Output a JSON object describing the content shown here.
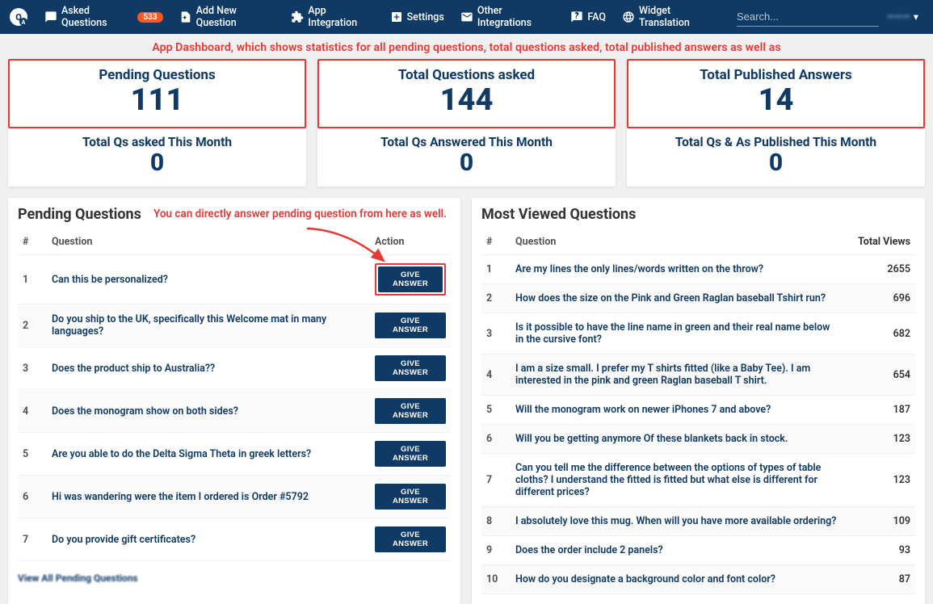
{
  "nav": {
    "items": [
      {
        "label": "Asked Questions",
        "badge": "533",
        "icon": "chat-icon"
      },
      {
        "label": "Add New Question",
        "icon": "note-add-icon"
      },
      {
        "label": "App Integration",
        "icon": "puzzle-icon"
      },
      {
        "label": "Settings",
        "icon": "plus-box-icon"
      },
      {
        "label": "Other Integrations",
        "icon": "mail-icon"
      },
      {
        "label": "FAQ",
        "icon": "faq-icon"
      },
      {
        "label": "Widget Translation",
        "icon": "globe-icon"
      }
    ],
    "search_placeholder": "Search...",
    "user_label": "———"
  },
  "annotations": {
    "banner": "App Dashboard, which shows statistics for all pending questions, total questions asked, total published answers as well as",
    "inline_pending": "You can directly answer pending question from here as well."
  },
  "stats": [
    {
      "top_label": "Pending Questions",
      "top_value": "111",
      "bottom_label": "Total Qs asked This Month",
      "bottom_value": "0"
    },
    {
      "top_label": "Total Questions asked",
      "top_value": "144",
      "bottom_label": "Total Qs Answered This Month",
      "bottom_value": "0"
    },
    {
      "top_label": "Total Published Answers",
      "top_value": "14",
      "bottom_label": "Total Qs & As Published This Month",
      "bottom_value": "0"
    }
  ],
  "pending": {
    "title": "Pending Questions",
    "headers": {
      "idx": "#",
      "question": "Question",
      "action": "Action"
    },
    "action_label": "GIVE ANSWER",
    "rows": [
      {
        "idx": "1",
        "q": "Can this be personalized?"
      },
      {
        "idx": "2",
        "q": "Do you ship to the UK, specifically this Welcome mat in many languages?"
      },
      {
        "idx": "3",
        "q": "Does the product ship to Australia??"
      },
      {
        "idx": "4",
        "q": "Does the monogram show on both sides?"
      },
      {
        "idx": "5",
        "q": "Are you able to do the Delta Sigma Theta in greek letters?"
      },
      {
        "idx": "6",
        "q": "Hi was wandering were the item I ordered is Order #5792"
      },
      {
        "idx": "7",
        "q": "Do you provide gift certificates?"
      }
    ],
    "view_all": "View All Pending Questions"
  },
  "most_viewed": {
    "title": "Most Viewed Questions",
    "headers": {
      "idx": "#",
      "question": "Question",
      "views": "Total Views"
    },
    "rows": [
      {
        "idx": "1",
        "q": "Are my lines the only lines/words written on the throw?",
        "views": "2655"
      },
      {
        "idx": "2",
        "q": "How does the size on the Pink and Green Raglan baseball Tshirt run?",
        "views": "696"
      },
      {
        "idx": "3",
        "q": "Is it possible to have the line name in green and their real name below in the cursive font?",
        "views": "682"
      },
      {
        "idx": "4",
        "q": "I am a size small. I prefer my T shirts fitted (like a Baby Tee). I am interested in the pink and green Raglan baseball T shirt.",
        "views": "654"
      },
      {
        "idx": "5",
        "q": "Will the monogram work on newer iPhones 7 and above?",
        "views": "187"
      },
      {
        "idx": "6",
        "q": "Will you be getting anymore Of these blankets back in stock.",
        "views": "123"
      },
      {
        "idx": "7",
        "q": "Can you tell me the difference between the options of types of table cloths? I understand the fitted is fitted but what else is different for different prices?",
        "views": "123"
      },
      {
        "idx": "8",
        "q": "I absolutely love this mug. When will you have more available ordering?",
        "views": "109"
      },
      {
        "idx": "9",
        "q": "Does the order include 2 panels?",
        "views": "93"
      },
      {
        "idx": "10",
        "q": "How do you designate a background color and font color?",
        "views": "87"
      }
    ]
  }
}
